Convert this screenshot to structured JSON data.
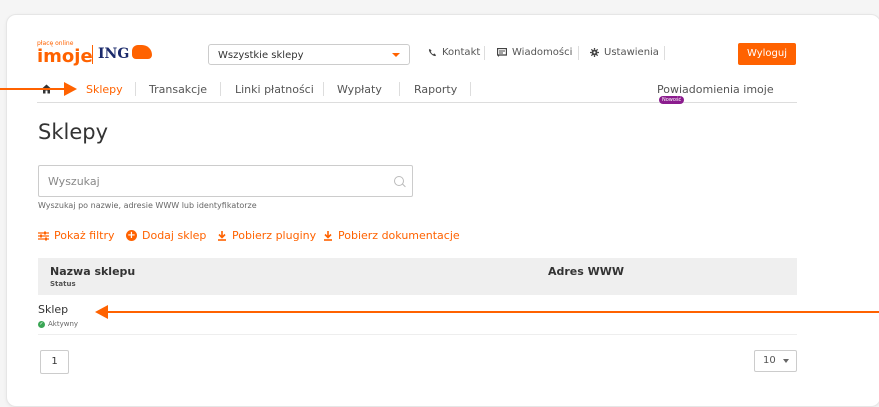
{
  "brand": {
    "tagline": "płacę online",
    "product": "imoje",
    "bank": "ING"
  },
  "header": {
    "shop_select_value": "Wszystkie sklepy",
    "contact": "Kontakt",
    "messages": "Wiadomości",
    "settings": "Ustawienia",
    "logout": "Wyloguj"
  },
  "nav": {
    "items": [
      {
        "label": "Sklepy"
      },
      {
        "label": "Transakcje"
      },
      {
        "label": "Linki płatności"
      },
      {
        "label": "Wypłaty"
      },
      {
        "label": "Raporty"
      }
    ],
    "notifications": "Powiadomienia imoje",
    "badge": "Nowość"
  },
  "main": {
    "title": "Sklepy",
    "search_placeholder": "Wyszukaj",
    "search_hint": "Wyszukaj po nazwie, adresie WWW lub identyfikatorze",
    "actions": {
      "filters": "Pokaż filtry",
      "add_shop": "Dodaj sklep",
      "plugins": "Pobierz pluginy",
      "docs": "Pobierz dokumentacje"
    }
  },
  "table": {
    "col_name": "Nazwa sklepu",
    "col_status": "Status",
    "col_www": "Adres WWW",
    "rows": [
      {
        "name": "Sklep",
        "status": "Aktywny",
        "www": ""
      }
    ]
  },
  "pagination": {
    "page": "1",
    "per_page": "10"
  },
  "colors": {
    "accent": "#ff6200",
    "status_active": "#3aa655",
    "badge": "#8b1c8e"
  }
}
